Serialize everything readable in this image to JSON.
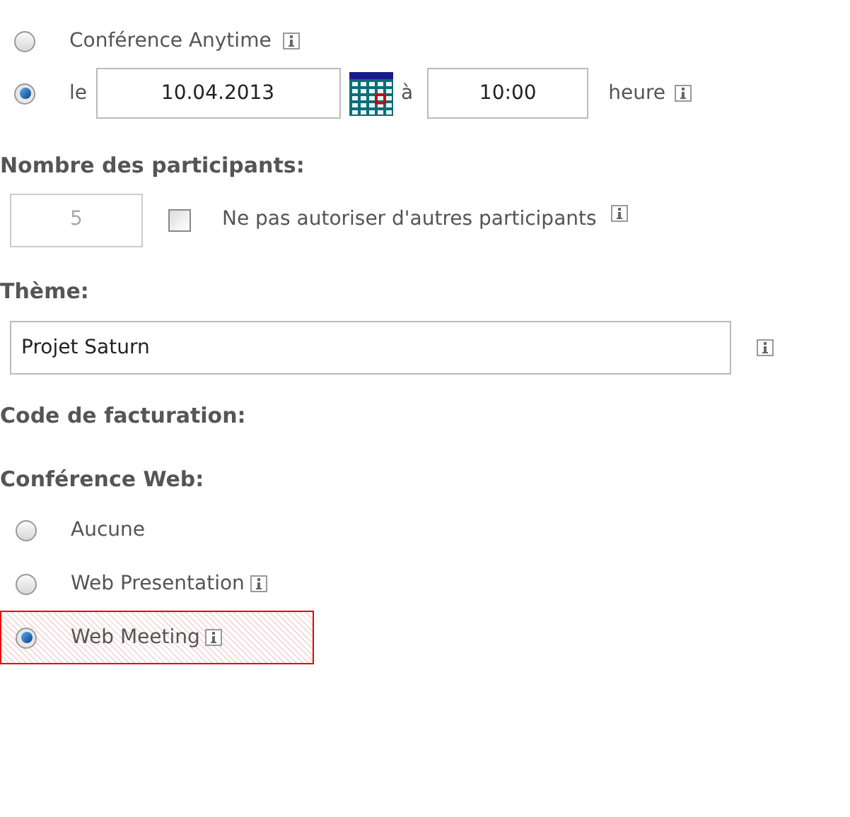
{
  "schedule": {
    "options": [
      {
        "kind": "anytime",
        "label": "Conférence Anytime",
        "selected": false
      },
      {
        "kind": "date",
        "label": "le",
        "date": "10.04.2013",
        "at": "à",
        "time": "10:00",
        "unit": "heure",
        "selected": true
      }
    ]
  },
  "participants": {
    "heading": "Nombre des participants:",
    "count": "5",
    "disabled": true,
    "checkbox_label": "Ne pas autoriser d'autres participants",
    "checked": false
  },
  "theme": {
    "heading": "Thème:",
    "value": "Projet Saturn"
  },
  "billing": {
    "heading": "Code de facturation:"
  },
  "web_conference": {
    "heading": "Conférence Web:",
    "options": [
      {
        "label": "Aucune",
        "selected": false,
        "info": false,
        "highlighted": false
      },
      {
        "label": "Web Presentation",
        "selected": false,
        "info": true,
        "highlighted": false
      },
      {
        "label": "Web Meeting",
        "selected": true,
        "info": true,
        "highlighted": true
      }
    ]
  }
}
